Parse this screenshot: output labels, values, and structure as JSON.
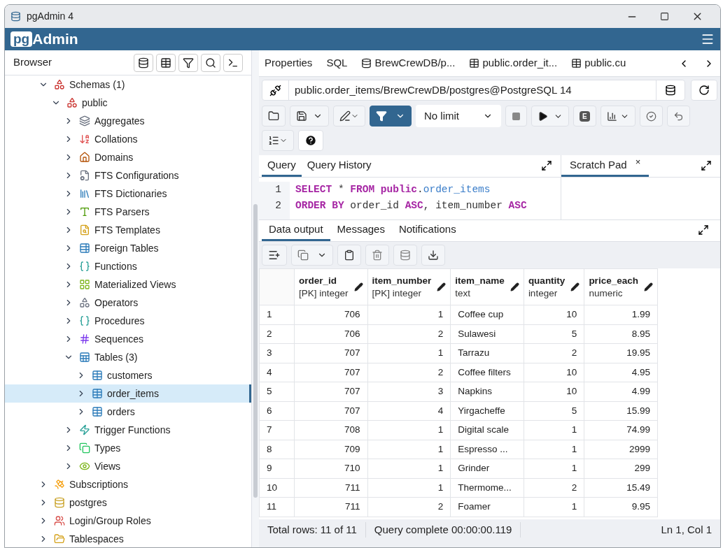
{
  "window": {
    "title": "pgAdmin 4"
  },
  "app_logo": {
    "prefix": "pg",
    "name": "Admin"
  },
  "browser": {
    "title": "Browser",
    "tree": [
      {
        "label": "Schemas (1)",
        "kind": "schema",
        "expanded": true,
        "selected": false,
        "children": [
          {
            "label": "public",
            "kind": "schema",
            "expanded": true,
            "selected": false,
            "children": [
              {
                "label": "Aggregates",
                "kind": "aggregate",
                "expanded": false,
                "selected": false
              },
              {
                "label": "Collations",
                "kind": "collation",
                "expanded": false,
                "selected": false
              },
              {
                "label": "Domains",
                "kind": "domain",
                "expanded": false,
                "selected": false
              },
              {
                "label": "FTS Configurations",
                "kind": "config",
                "expanded": false,
                "selected": false
              },
              {
                "label": "FTS Dictionaries",
                "kind": "dictionary",
                "expanded": false,
                "selected": false
              },
              {
                "label": "FTS Parsers",
                "kind": "parser",
                "expanded": false,
                "selected": false
              },
              {
                "label": "FTS Templates",
                "kind": "template",
                "expanded": false,
                "selected": false
              },
              {
                "label": "Foreign Tables",
                "kind": "foreign",
                "expanded": false,
                "selected": false
              },
              {
                "label": "Functions",
                "kind": "function",
                "expanded": false,
                "selected": false
              },
              {
                "label": "Materialized Views",
                "kind": "matview",
                "expanded": false,
                "selected": false
              },
              {
                "label": "Operators",
                "kind": "operator",
                "expanded": false,
                "selected": false
              },
              {
                "label": "Procedures",
                "kind": "procedure",
                "expanded": false,
                "selected": false
              },
              {
                "label": "Sequences",
                "kind": "sequence",
                "expanded": false,
                "selected": false
              },
              {
                "label": "Tables (3)",
                "kind": "tables",
                "expanded": true,
                "selected": false,
                "children": [
                  {
                    "label": "customers",
                    "kind": "table",
                    "expanded": false,
                    "selected": false
                  },
                  {
                    "label": "order_items",
                    "kind": "table",
                    "expanded": false,
                    "selected": true
                  },
                  {
                    "label": "orders",
                    "kind": "table",
                    "expanded": false,
                    "selected": false
                  }
                ]
              },
              {
                "label": "Trigger Functions",
                "kind": "trigger",
                "expanded": false,
                "selected": false
              },
              {
                "label": "Types",
                "kind": "type",
                "expanded": false,
                "selected": false
              },
              {
                "label": "Views",
                "kind": "view",
                "expanded": false,
                "selected": false
              }
            ]
          }
        ]
      },
      {
        "label": "Subscriptions",
        "kind": "subscription",
        "expanded": false,
        "selected": false
      },
      {
        "label": "postgres",
        "kind": "database",
        "expanded": false,
        "selected": false
      },
      {
        "label": "Login/Group Roles",
        "kind": "roles",
        "expanded": false,
        "selected": false
      },
      {
        "label": "Tablespaces",
        "kind": "tablespace",
        "expanded": false,
        "selected": false
      }
    ]
  },
  "tabs": [
    {
      "label": "Properties",
      "kind": "plain"
    },
    {
      "label": "SQL",
      "kind": "plain"
    },
    {
      "label": "BrewCrewDB/p...",
      "kind": "database"
    },
    {
      "label": "public.order_it...",
      "kind": "table"
    },
    {
      "label": "public.cu",
      "kind": "table"
    }
  ],
  "connection": "public.order_items/BrewCrewDB/postgres@PostgreSQL 14",
  "limit": "No limit",
  "explain_label": "E",
  "query_tabs": [
    {
      "label": "Query",
      "selected": true
    },
    {
      "label": "Query History",
      "selected": false
    }
  ],
  "scratch_tab": {
    "label": "Scratch Pad",
    "close": "×",
    "selected": true
  },
  "editor": {
    "lines": [
      [
        {
          "text": "SELECT",
          "kind": "keyword"
        },
        {
          "text": " * ",
          "kind": "plain"
        },
        {
          "text": "FROM",
          "kind": "keyword"
        },
        {
          "text": " public",
          "kind": "keyword"
        },
        {
          "text": ".",
          "kind": "plain"
        },
        {
          "text": "order_items",
          "kind": "identifier"
        }
      ],
      [
        {
          "text": "ORDER BY",
          "kind": "keyword"
        },
        {
          "text": " order_id ",
          "kind": "plain"
        },
        {
          "text": "ASC",
          "kind": "keyword"
        },
        {
          "text": ", item_number ",
          "kind": "plain"
        },
        {
          "text": "ASC",
          "kind": "keyword"
        }
      ]
    ],
    "line_numbers": [
      "1",
      "2"
    ]
  },
  "output_tabs": [
    {
      "label": "Data output",
      "selected": true
    },
    {
      "label": "Messages",
      "selected": false
    },
    {
      "label": "Notifications",
      "selected": false
    }
  ],
  "table": {
    "columns": [
      {
        "name": "order_id",
        "type": "[PK] integer",
        "kind": "number"
      },
      {
        "name": "item_number",
        "type": "[PK] integer",
        "kind": "number"
      },
      {
        "name": "item_name",
        "type": "text",
        "kind": "text"
      },
      {
        "name": "quantity",
        "type": "integer",
        "kind": "number"
      },
      {
        "name": "price_each",
        "type": "numeric",
        "kind": "number"
      }
    ],
    "rows": [
      {
        "number": "1",
        "cells": [
          "706",
          "1",
          "Coffee cup",
          "10",
          "1.99"
        ]
      },
      {
        "number": "2",
        "cells": [
          "706",
          "2",
          "Sulawesi",
          "5",
          "8.95"
        ]
      },
      {
        "number": "3",
        "cells": [
          "707",
          "1",
          "Tarrazu",
          "2",
          "19.95"
        ]
      },
      {
        "number": "4",
        "cells": [
          "707",
          "2",
          "Coffee filters",
          "10",
          "4.95"
        ]
      },
      {
        "number": "5",
        "cells": [
          "707",
          "3",
          "Napkins",
          "10",
          "4.99"
        ]
      },
      {
        "number": "6",
        "cells": [
          "707",
          "4",
          "Yirgacheffe",
          "5",
          "15.99"
        ]
      },
      {
        "number": "7",
        "cells": [
          "708",
          "1",
          "Digital scale",
          "1",
          "74.99"
        ]
      },
      {
        "number": "8",
        "cells": [
          "709",
          "1",
          "Espresso ...",
          "1",
          "2999"
        ]
      },
      {
        "number": "9",
        "cells": [
          "710",
          "1",
          "Grinder",
          "1",
          "299"
        ]
      },
      {
        "number": "10",
        "cells": [
          "711",
          "1",
          "Thermome...",
          "2",
          "15.49"
        ]
      },
      {
        "number": "11",
        "cells": [
          "711",
          "2",
          "Foamer",
          "1",
          "9.95"
        ]
      }
    ]
  },
  "status_bar": {
    "total": "Total rows: 11 of 11",
    "query": "Query complete 00:00:00.119",
    "position": "Ln 1, Col 1"
  }
}
